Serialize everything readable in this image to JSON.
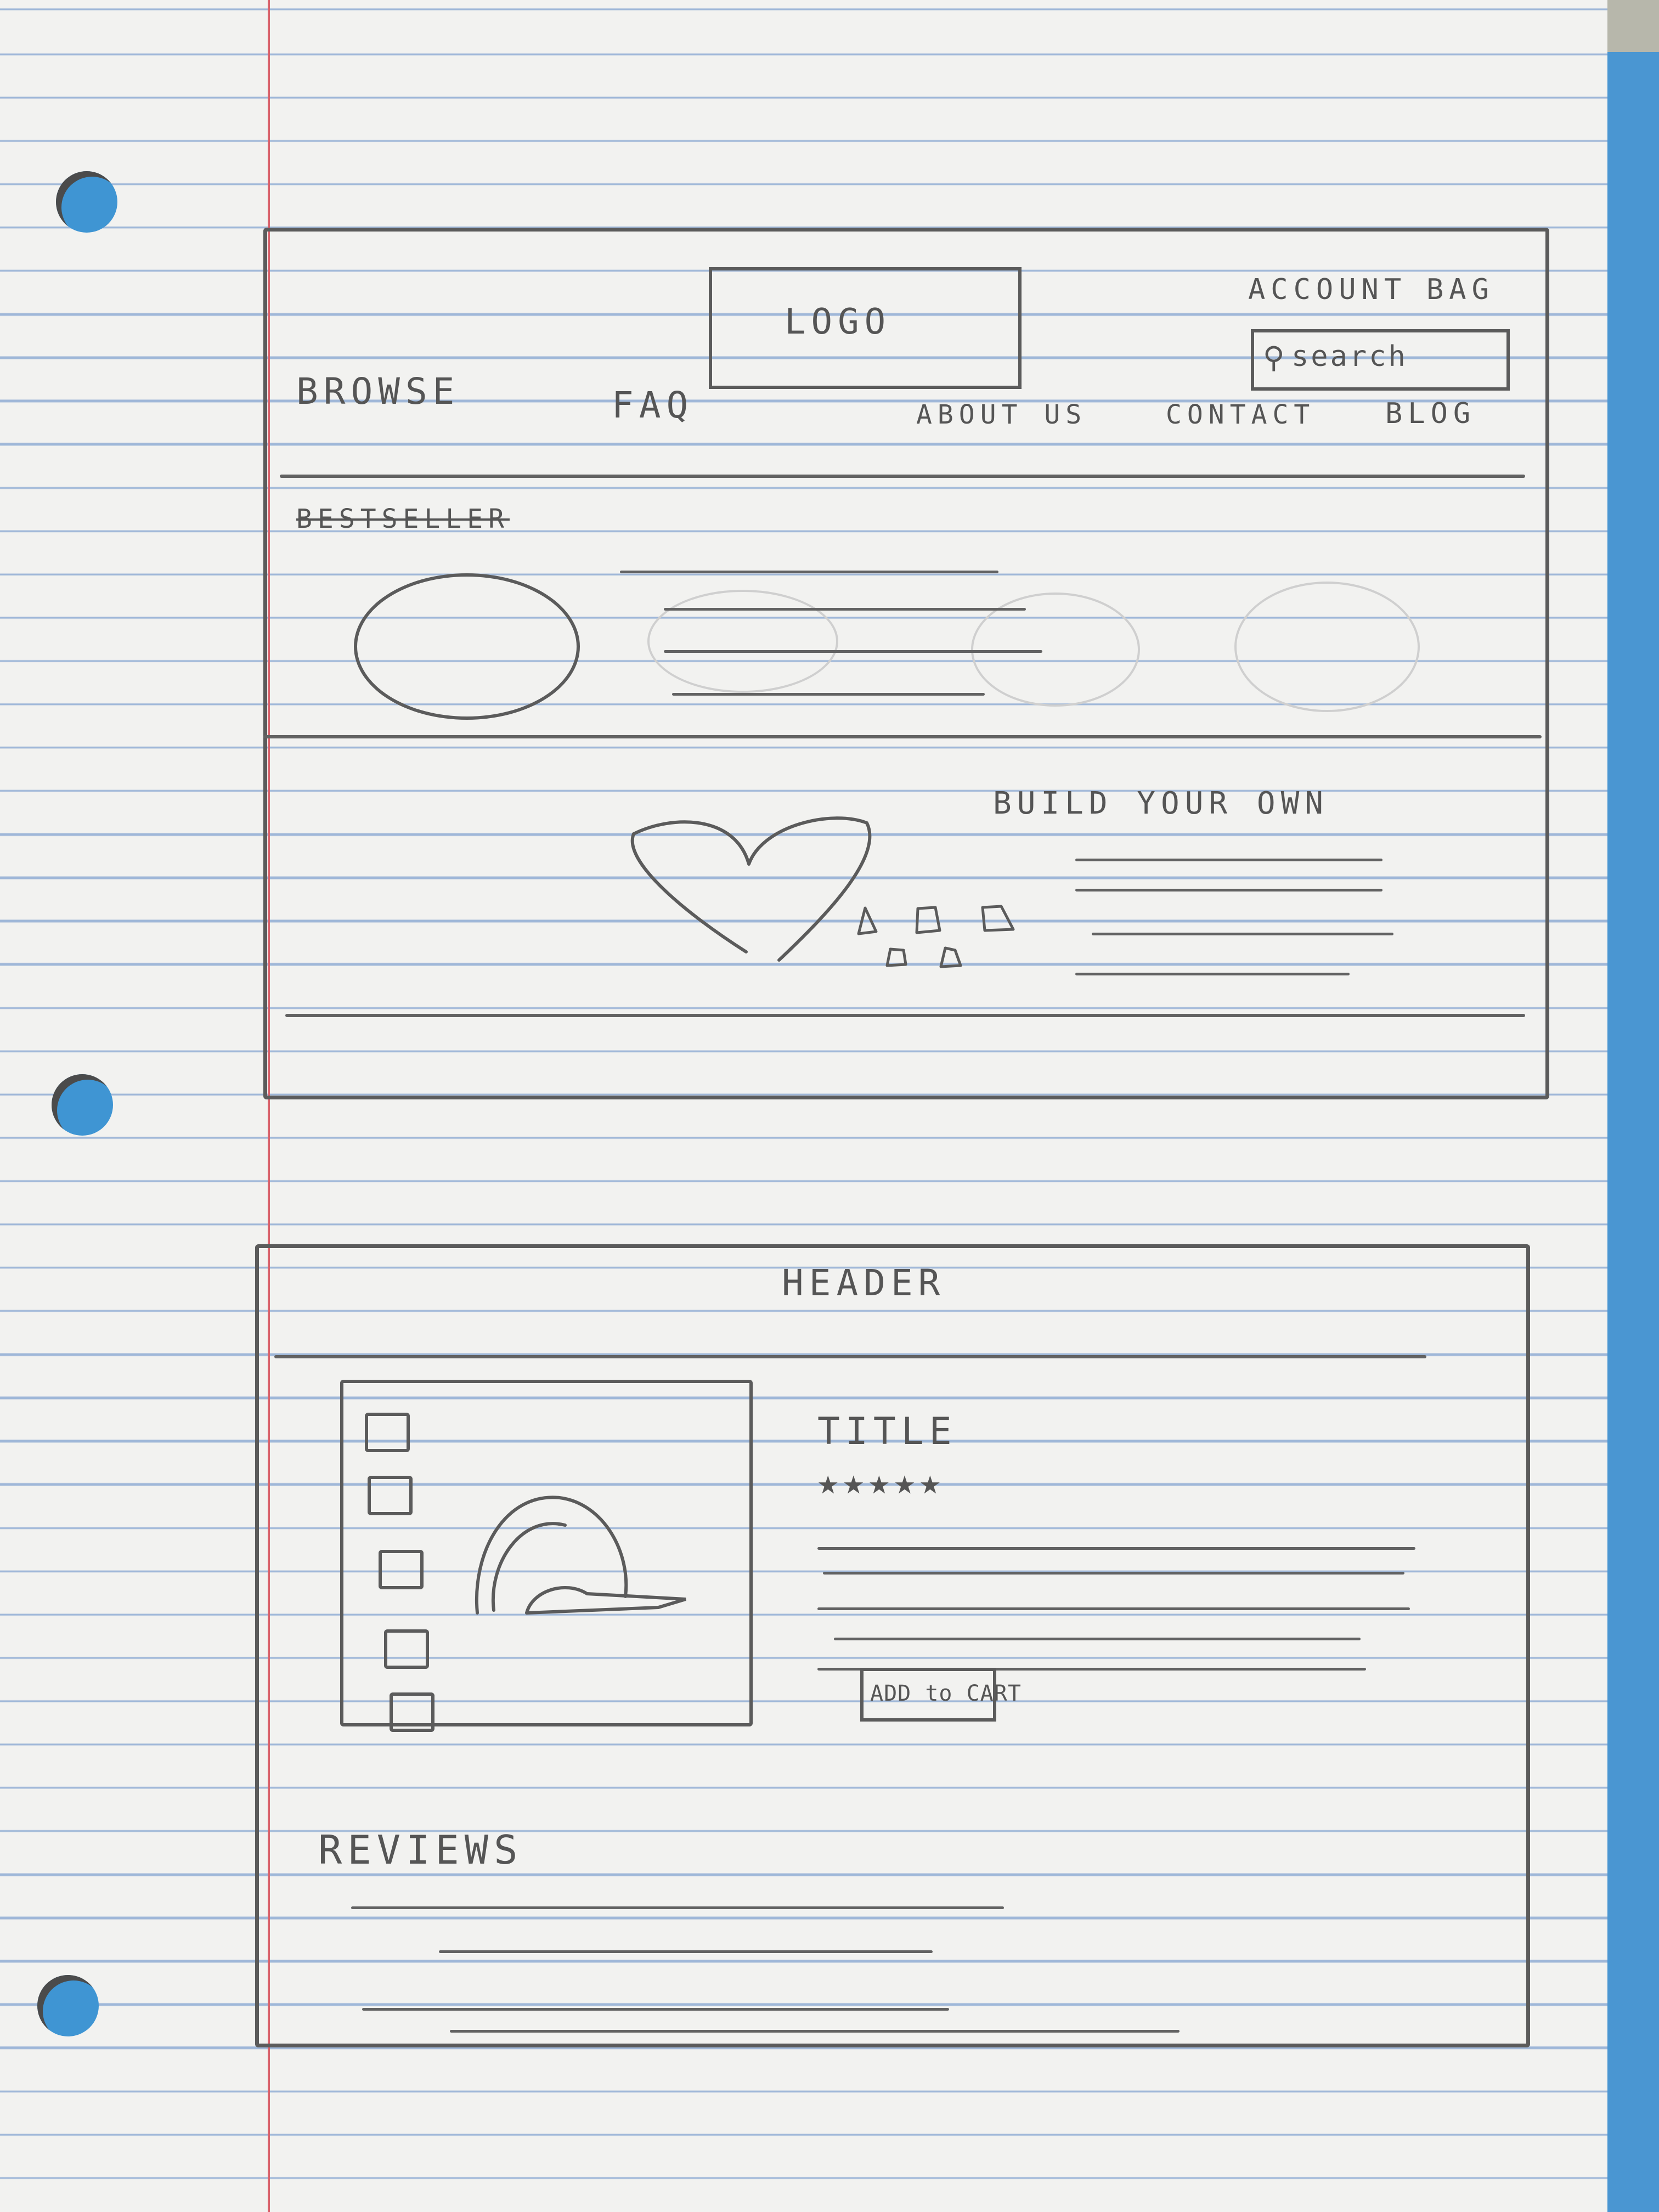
{
  "wireframe_1": {
    "header": {
      "logo": "LOGO",
      "account_link": "ACCOUNT",
      "bag_link": "BAG",
      "search_placeholder": "search",
      "nav": [
        "BROWSE",
        "FAQ",
        "ABOUT US",
        "CONTACT",
        "BLOG"
      ]
    },
    "bestseller": {
      "heading": "BESTSELLER"
    },
    "build_your_own": {
      "heading": "BUILD YOUR OWN"
    }
  },
  "wireframe_2": {
    "header": "HEADER",
    "product": {
      "title": "TITLE",
      "rating_stars": 5,
      "add_to_cart_label": "ADD to CART"
    },
    "reviews": {
      "heading": "REVIEWS"
    }
  },
  "colors": {
    "pencil": "#5b5b5b",
    "paper": "#f2f2f0",
    "rule": "#9fb7d8",
    "margin": "#d9636c",
    "binder": "#4a96d2"
  }
}
